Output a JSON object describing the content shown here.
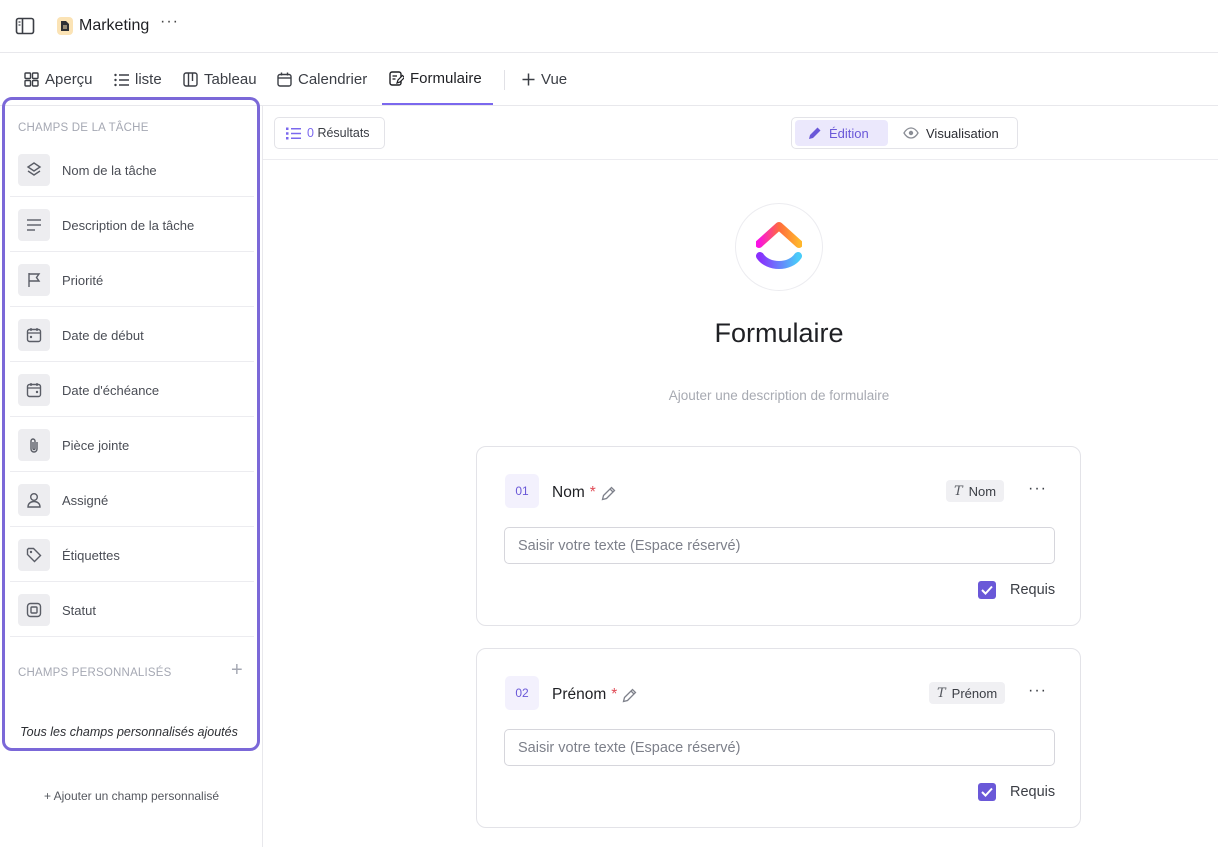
{
  "header": {
    "title": "Marketing",
    "more": "···",
    "doc_icon": "document-icon",
    "sidebar_toggle_icon": "sidebar-toggle-icon"
  },
  "tabs": [
    {
      "label": "Aperçu",
      "icon": "overview-grid-icon"
    },
    {
      "label": "liste",
      "icon": "list-icon"
    },
    {
      "label": "Tableau",
      "icon": "board-icon"
    },
    {
      "label": "Calendrier",
      "icon": "calendar-icon"
    },
    {
      "label": "Formulaire",
      "icon": "form-icon",
      "active": true
    },
    {
      "label": "Vue",
      "icon": "plus-icon"
    }
  ],
  "sidebar": {
    "task_fields_header": "CHAMPS DE LA TÂCHE",
    "fields": [
      {
        "label": "Nom de la tâche",
        "icon": "task-name-icon"
      },
      {
        "label": "Description de la tâche",
        "icon": "description-icon"
      },
      {
        "label": "Priorité",
        "icon": "flag-icon"
      },
      {
        "label": "Date de début",
        "icon": "calendar-start-icon"
      },
      {
        "label": "Date d'échéance",
        "icon": "calendar-due-icon"
      },
      {
        "label": "Pièce jointe",
        "icon": "paperclip-icon"
      },
      {
        "label": "Assigné",
        "icon": "user-icon"
      },
      {
        "label": "Étiquettes",
        "icon": "tag-icon"
      },
      {
        "label": "Statut",
        "icon": "status-icon"
      }
    ],
    "custom_fields_header": "CHAMPS PERSONNALISÉS",
    "custom_fields_note": "Tous les champs personnalisés ajoutés",
    "add_custom_field": "+ Ajouter un champ personnalisé"
  },
  "toolbar": {
    "results_count": "0",
    "results_label": "Résultats",
    "mode_edit": "Édition",
    "mode_view": "Visualisation"
  },
  "form": {
    "title": "Formulaire",
    "description_placeholder": "Ajouter une description de formulaire",
    "questions": [
      {
        "number": "01",
        "label": "Nom",
        "required_marker": "*",
        "type": "Nom",
        "placeholder": "Saisir votre texte (Espace réservé)",
        "required_label": "Requis",
        "required": true
      },
      {
        "number": "02",
        "label": "Prénom",
        "required_marker": "*",
        "type": "Prénom",
        "placeholder": "Saisir votre texte (Espace réservé)",
        "required_label": "Requis",
        "required": true
      }
    ]
  },
  "colors": {
    "accent": "#7b68ee",
    "highlight_border": "#7b68d8",
    "required_star": "#e04a55"
  }
}
